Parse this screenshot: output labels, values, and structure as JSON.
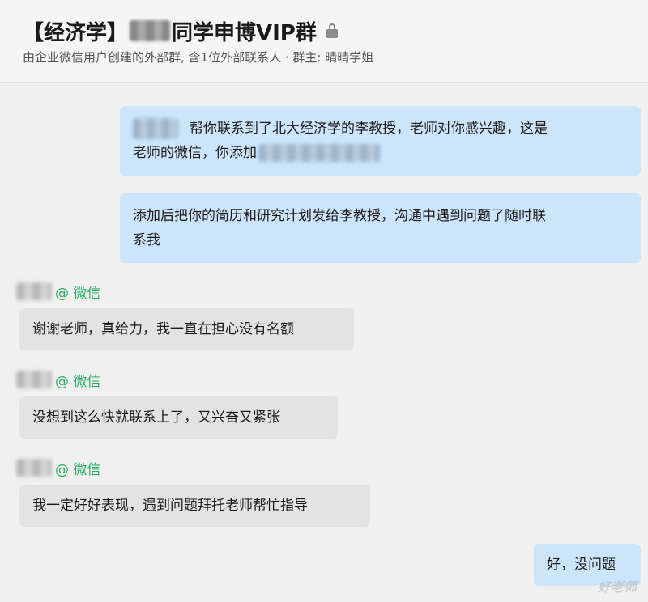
{
  "header": {
    "title_prefix": "【经济学】",
    "title_suffix": "同学申博VIP群",
    "subtitle": "由企业微信用户创建的外部群, 含1位外部联系人 · 群主: 晴晴学姐"
  },
  "messages": [
    {
      "side": "self",
      "line1": "帮你联系到了北大经济学的李教授，老师对你感兴趣，这是",
      "line2": "老师的微信，你添加"
    },
    {
      "side": "self",
      "line1": "添加后把你的简历和研究计划发给李教授，沟通中遇到问题了随时联",
      "line2": "系我"
    },
    {
      "side": "other",
      "sender_suffix": "@ 微信",
      "text": "谢谢老师，真给力，我一直在担心没有名额"
    },
    {
      "side": "other",
      "sender_suffix": "@ 微信",
      "text": "没想到这么快就联系上了，又兴奋又紧张"
    },
    {
      "side": "other",
      "sender_suffix": "@ 微信",
      "text": "我一定好好表现，遇到问题拜托老师帮忙指导"
    },
    {
      "side": "self",
      "text": "好，没问题"
    }
  ],
  "watermark": "好老师",
  "colors": {
    "self_bubble": "#cce5fb",
    "other_bubble": "#e3e3e3",
    "wechat_green": "#2aae67"
  },
  "icons": {
    "title_badge": "lock-icon"
  }
}
